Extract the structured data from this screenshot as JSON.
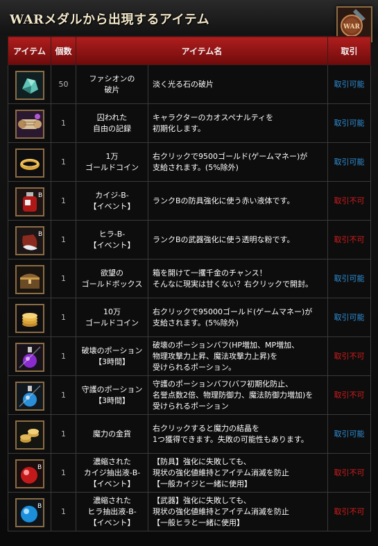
{
  "header": {
    "title": "WARメダルから出現するアイテム",
    "medal_text": "WAR"
  },
  "table": {
    "columns": [
      "アイテム",
      "個数",
      "アイテム名",
      "取引"
    ],
    "rows": [
      {
        "icon": "stone-fragment-icon",
        "count": "50",
        "name": [
          "ファシオンの",
          "破片"
        ],
        "desc": [
          "淡く光る石の破片"
        ],
        "trade": "取引可能",
        "tradable": true
      },
      {
        "icon": "scroll-icon",
        "count": "1",
        "name": [
          "囚われた",
          "自由の記録"
        ],
        "desc": [
          "キャラクターのカオスペナルティを",
          "初期化します。"
        ],
        "trade": "取引可能",
        "tradable": true
      },
      {
        "icon": "gold-ring-icon",
        "count": "1",
        "name": [
          "1万",
          "ゴールドコイン"
        ],
        "desc": [
          "右クリックで9500ゴールド(ゲームマネー)が",
          "支給されます。(5%除外)"
        ],
        "trade": "取引可能",
        "tradable": true
      },
      {
        "icon": "red-potion-bottle-icon",
        "count": "1",
        "name": [
          "カイジ-B-",
          "【イベント】"
        ],
        "desc": [
          "ランクBの防具強化に使う赤い液体です。"
        ],
        "trade": "取引不可",
        "tradable": false
      },
      {
        "icon": "powder-bag-icon",
        "count": "1",
        "name": [
          "ヒラ-B-",
          "【イベント】"
        ],
        "desc": [
          "ランクBの武器強化に使う透明な粉です。"
        ],
        "trade": "取引不可",
        "tradable": false
      },
      {
        "icon": "treasure-chest-icon",
        "count": "1",
        "name": [
          "欲望の",
          "ゴールドボックス"
        ],
        "desc": [
          "箱を開けて一攫千金のチャンス！",
          "そんなに現実は甘くない？右クリックで開封。"
        ],
        "trade": "取引可能",
        "tradable": true
      },
      {
        "icon": "gold-coins-icon",
        "count": "1",
        "name": [
          "10万",
          "ゴールドコイン"
        ],
        "desc": [
          "右クリックで95000ゴールド(ゲームマネー)が",
          "支給されます。(5%除外)"
        ],
        "trade": "取引可能",
        "tradable": true
      },
      {
        "icon": "purple-flask-icon",
        "count": "1",
        "name": [
          "破壊のポーション",
          "【3時間】"
        ],
        "desc": [
          "破壊のポーションバフ(HP増加、MP増加、",
          "物理攻撃力上昇、魔法攻撃力上昇)を",
          "受けられるポーション。"
        ],
        "trade": "取引不可",
        "tradable": false
      },
      {
        "icon": "blue-flask-icon",
        "count": "1",
        "name": [
          "守護のポーション",
          "【3時間】"
        ],
        "desc": [
          "守護のポーションバフ(バフ初期化防止、",
          "名誉点数2倍、物理防御力、魔法防御力増加)を",
          "受けられるポーション"
        ],
        "trade": "取引不可",
        "tradable": false
      },
      {
        "icon": "magic-coins-icon",
        "count": "1",
        "name": [
          "魔力の金貨"
        ],
        "desc": [
          "右クリックすると魔力の結晶を",
          "1つ獲得できます。失敗の可能性もあります。"
        ],
        "trade": "取引可能",
        "tradable": true
      },
      {
        "icon": "red-orb-icon",
        "count": "1",
        "name": [
          "濃縮された",
          "カイジ抽出液-B-",
          "【イベント】"
        ],
        "desc": [
          "【防具】強化に失敗しても、",
          "現状の強化値維持とアイテム消滅を防止",
          "【一般カイジと一緒に使用】"
        ],
        "trade": "取引不可",
        "tradable": false
      },
      {
        "icon": "blue-orb-icon",
        "count": "1",
        "name": [
          "濃縮された",
          "ヒラ抽出液-B-",
          "【イベント】"
        ],
        "desc": [
          "【武器】強化に失敗しても、",
          "現状の強化値維持とアイテム消滅を防止",
          "【一般ヒラと一緒に使用】"
        ],
        "trade": "取引不可",
        "tradable": false
      }
    ]
  }
}
